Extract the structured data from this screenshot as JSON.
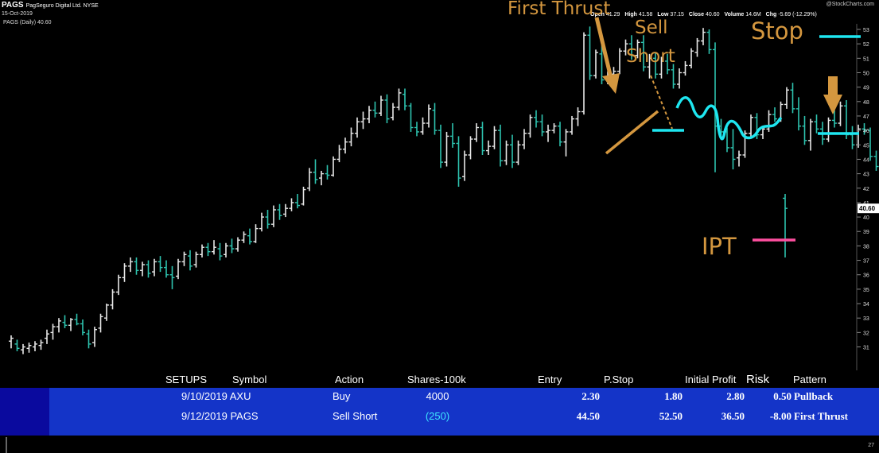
{
  "header": {
    "symbol": "PAGS",
    "company": "PagSeguro Digital Ltd.  NYSE",
    "date": "15-Oct-2019",
    "legend": "PAGS (Daily) 40.60",
    "watermark": "@StockCharts.com",
    "ohlc": {
      "open_label": "Open",
      "open": "41.29",
      "high_label": "High",
      "high": "41.58",
      "low_label": "Low",
      "low": "37.15",
      "close_label": "Close",
      "close": "40.60",
      "volume_label": "Volume",
      "volume": "14.6M",
      "chg_label": "Chg",
      "chg": "-5.69 (-12.29%)"
    }
  },
  "annotations": {
    "first_thrust": "First Thrust",
    "sell": "Sell",
    "short": "Short",
    "stop": "Stop",
    "ipt": "IPT"
  },
  "colors": {
    "up_bar": "#e8e8e8",
    "down_bar": "#2ec4b0",
    "annotation": "#d4973f",
    "cyan": "#1ee6f0",
    "magenta": "#ff4fa0",
    "table_bg": "#1434c8"
  },
  "chart_data": {
    "type": "bar",
    "subtype": "ohlc",
    "title": "PAGS (Daily) 40.60",
    "ylim": [
      30.5,
      53.5
    ],
    "y_ticks": [
      31,
      32,
      33,
      34,
      35,
      36,
      37,
      38,
      39,
      40,
      41,
      42,
      43,
      44,
      45,
      46,
      47,
      48,
      49,
      50,
      51,
      52,
      53
    ],
    "last_price_label": "40.60",
    "x_days": 133,
    "bars": [
      [
        31.4,
        31.8,
        30.9,
        31.6
      ],
      [
        31.2,
        31.5,
        30.7,
        30.9
      ],
      [
        30.8,
        31.2,
        30.5,
        31.0
      ],
      [
        30.9,
        31.3,
        30.6,
        31.1
      ],
      [
        31.0,
        31.4,
        30.7,
        31.2
      ],
      [
        31.1,
        31.5,
        30.8,
        31.3
      ],
      [
        31.6,
        32.2,
        31.2,
        31.9
      ],
      [
        32.0,
        32.6,
        31.5,
        32.4
      ],
      [
        32.4,
        33.0,
        32.0,
        32.8
      ],
      [
        32.7,
        33.2,
        32.3,
        32.5
      ],
      [
        32.5,
        33.0,
        32.1,
        32.9
      ],
      [
        32.9,
        33.3,
        32.5,
        32.6
      ],
      [
        32.6,
        32.9,
        31.8,
        32.0
      ],
      [
        31.9,
        32.2,
        30.9,
        31.2
      ],
      [
        31.3,
        32.4,
        31.0,
        32.2
      ],
      [
        32.3,
        33.3,
        32.0,
        33.1
      ],
      [
        33.0,
        34.0,
        32.8,
        33.9
      ],
      [
        33.9,
        35.0,
        33.6,
        34.8
      ],
      [
        34.8,
        36.0,
        34.6,
        35.8
      ],
      [
        35.8,
        36.8,
        35.5,
        36.6
      ],
      [
        36.6,
        37.2,
        36.2,
        36.9
      ],
      [
        36.9,
        37.2,
        36.0,
        36.3
      ],
      [
        36.3,
        36.9,
        35.9,
        36.7
      ],
      [
        36.7,
        37.0,
        35.8,
        36.1
      ],
      [
        36.2,
        37.1,
        35.9,
        36.9
      ],
      [
        36.9,
        37.3,
        36.2,
        36.5
      ],
      [
        36.5,
        37.0,
        35.8,
        36.0
      ],
      [
        36.0,
        36.6,
        35.0,
        35.8
      ],
      [
        35.9,
        37.1,
        35.7,
        36.9
      ],
      [
        36.9,
        37.6,
        36.6,
        37.4
      ],
      [
        37.3,
        37.7,
        36.3,
        36.6
      ],
      [
        36.7,
        37.6,
        36.5,
        37.4
      ],
      [
        37.4,
        38.1,
        37.2,
        37.9
      ],
      [
        37.9,
        38.2,
        37.3,
        37.6
      ],
      [
        37.6,
        38.4,
        37.4,
        37.9
      ],
      [
        37.8,
        38.2,
        37.0,
        37.3
      ],
      [
        37.4,
        38.2,
        37.2,
        38.0
      ],
      [
        38.0,
        38.5,
        37.5,
        37.8
      ],
      [
        37.8,
        38.6,
        37.6,
        38.4
      ],
      [
        38.4,
        39.0,
        38.2,
        38.8
      ],
      [
        38.7,
        39.2,
        38.1,
        38.3
      ],
      [
        38.3,
        39.5,
        38.2,
        39.2
      ],
      [
        39.2,
        40.3,
        39.0,
        40.0
      ],
      [
        40.0,
        40.5,
        39.2,
        39.5
      ],
      [
        39.5,
        40.8,
        39.3,
        40.5
      ],
      [
        40.5,
        40.9,
        39.8,
        40.1
      ],
      [
        40.2,
        40.9,
        40.0,
        40.6
      ],
      [
        40.6,
        41.3,
        40.4,
        41.0
      ],
      [
        41.0,
        41.6,
        40.6,
        40.8
      ],
      [
        40.9,
        42.1,
        40.8,
        41.9
      ],
      [
        42.0,
        43.4,
        41.8,
        43.1
      ],
      [
        43.1,
        44.0,
        42.3,
        42.6
      ],
      [
        42.7,
        43.2,
        42.2,
        43.0
      ],
      [
        43.0,
        43.6,
        42.6,
        42.9
      ],
      [
        42.9,
        44.2,
        42.8,
        44.0
      ],
      [
        44.0,
        45.0,
        43.8,
        44.7
      ],
      [
        44.7,
        45.5,
        44.4,
        45.2
      ],
      [
        45.2,
        46.2,
        44.9,
        45.8
      ],
      [
        45.8,
        46.9,
        45.5,
        46.6
      ],
      [
        46.6,
        47.3,
        46.1,
        46.8
      ],
      [
        46.8,
        47.7,
        46.5,
        47.4
      ],
      [
        47.4,
        48.0,
        46.9,
        47.2
      ],
      [
        47.2,
        48.4,
        47.0,
        48.1
      ],
      [
        48.1,
        48.5,
        46.5,
        46.8
      ],
      [
        46.9,
        47.9,
        46.7,
        47.6
      ],
      [
        47.6,
        48.9,
        47.4,
        48.6
      ],
      [
        48.5,
        48.9,
        47.4,
        47.7
      ],
      [
        47.7,
        47.9,
        45.9,
        46.2
      ],
      [
        46.2,
        46.6,
        45.6,
        45.9
      ],
      [
        45.9,
        46.9,
        45.7,
        46.5
      ],
      [
        46.5,
        47.8,
        46.2,
        47.5
      ],
      [
        47.4,
        47.9,
        45.7,
        46.0
      ],
      [
        46.0,
        46.4,
        43.4,
        43.8
      ],
      [
        43.8,
        45.9,
        43.5,
        45.6
      ],
      [
        45.6,
        46.5,
        44.8,
        45.1
      ],
      [
        45.1,
        45.6,
        42.1,
        42.7
      ],
      [
        42.8,
        44.6,
        42.5,
        44.3
      ],
      [
        44.3,
        45.6,
        44.0,
        45.4
      ],
      [
        45.4,
        46.5,
        45.2,
        46.2
      ],
      [
        46.2,
        46.6,
        44.3,
        44.6
      ],
      [
        44.6,
        45.3,
        44.3,
        44.9
      ],
      [
        44.9,
        46.3,
        44.7,
        46.0
      ],
      [
        46.0,
        46.4,
        43.5,
        43.9
      ],
      [
        43.9,
        45.3,
        43.6,
        45.0
      ],
      [
        45.0,
        45.7,
        43.4,
        43.8
      ],
      [
        43.8,
        45.3,
        43.6,
        45.0
      ],
      [
        45.0,
        46.1,
        44.7,
        45.8
      ],
      [
        45.8,
        47.1,
        45.5,
        46.9
      ],
      [
        46.9,
        47.4,
        46.2,
        46.6
      ],
      [
        46.6,
        47.1,
        45.6,
        45.9
      ],
      [
        45.9,
        46.4,
        45.2,
        46.0
      ],
      [
        46.0,
        46.5,
        45.8,
        46.3
      ],
      [
        46.3,
        46.6,
        44.9,
        45.2
      ],
      [
        45.2,
        46.1,
        44.2,
        45.9
      ],
      [
        45.9,
        47.0,
        45.7,
        46.8
      ],
      [
        46.8,
        47.6,
        46.3,
        47.3
      ],
      [
        47.3,
        52.8,
        47.1,
        52.6
      ],
      [
        52.6,
        53.2,
        49.5,
        49.8
      ],
      [
        49.8,
        51.6,
        49.6,
        51.4
      ],
      [
        51.3,
        51.9,
        49.2,
        49.5
      ],
      [
        49.5,
        50.1,
        49.2,
        49.9
      ],
      [
        49.9,
        50.4,
        49.4,
        50.1
      ],
      [
        50.1,
        51.7,
        49.9,
        51.5
      ],
      [
        51.5,
        52.3,
        51.2,
        52.0
      ],
      [
        52.0,
        52.6,
        50.9,
        51.2
      ],
      [
        51.2,
        52.3,
        51.0,
        52.1
      ],
      [
        52.1,
        52.6,
        50.1,
        50.4
      ],
      [
        50.4,
        51.3,
        49.6,
        51.0
      ],
      [
        51.0,
        51.4,
        49.6,
        49.9
      ],
      [
        49.9,
        51.1,
        49.6,
        50.8
      ],
      [
        50.8,
        51.3,
        49.9,
        50.2
      ],
      [
        50.2,
        50.6,
        48.9,
        49.2
      ],
      [
        49.2,
        50.3,
        48.9,
        50.0
      ],
      [
        50.0,
        50.8,
        49.8,
        50.5
      ],
      [
        50.5,
        51.7,
        50.3,
        51.5
      ],
      [
        51.4,
        52.4,
        51.1,
        52.2
      ],
      [
        52.2,
        53.1,
        51.9,
        52.8
      ],
      [
        52.8,
        53.0,
        51.3,
        51.6
      ],
      [
        51.6,
        52.1,
        43.1,
        46.3
      ],
      [
        46.3,
        46.8,
        45.6,
        45.9
      ],
      [
        45.9,
        46.2,
        44.5,
        44.8
      ],
      [
        44.8,
        46.1,
        43.3,
        44.0
      ],
      [
        44.1,
        44.6,
        43.5,
        44.3
      ],
      [
        44.3,
        46.0,
        44.1,
        45.8
      ],
      [
        45.8,
        47.1,
        45.5,
        46.9
      ],
      [
        46.9,
        47.2,
        45.4,
        45.7
      ],
      [
        45.7,
        46.3,
        45.4,
        46.1
      ],
      [
        46.1,
        47.4,
        45.9,
        47.1
      ],
      [
        47.1,
        47.6,
        46.6,
        46.8
      ],
      [
        46.8,
        48.0,
        46.6,
        47.8
      ],
      [
        47.8,
        49.0,
        47.5,
        48.8
      ],
      [
        48.8,
        49.3,
        47.2,
        47.5
      ],
      [
        47.5,
        48.3,
        46.0,
        46.3
      ],
      [
        46.3,
        47.0,
        45.0,
        45.3
      ],
      [
        45.3,
        46.8,
        44.6,
        46.6
      ],
      [
        46.6,
        47.1,
        45.8,
        46.1
      ],
      [
        46.1,
        46.6,
        45.0,
        45.4
      ],
      [
        45.4,
        46.9,
        45.2,
        46.7
      ],
      [
        46.7,
        47.4,
        46.2,
        46.5
      ],
      [
        46.5,
        48.0,
        46.3,
        47.7
      ],
      [
        47.7,
        48.1,
        45.4,
        45.7
      ],
      [
        45.7,
        46.3,
        44.7,
        45.0
      ],
      [
        45.0,
        46.4,
        44.8,
        46.1
      ],
      [
        46.1,
        46.5,
        45.7,
        46.0
      ],
      [
        46.0,
        46.2,
        43.9,
        44.2
      ],
      [
        44.2,
        44.6,
        43.2,
        43.5
      ],
      [
        43.5,
        44.7,
        43.1,
        44.4
      ],
      [
        44.4,
        45.2,
        43.8,
        45.0
      ],
      [
        45.0,
        46.0,
        44.8,
        45.7
      ],
      [
        45.7,
        46.3,
        45.4,
        45.9
      ],
      [
        45.9,
        46.2,
        44.9,
        45.2
      ],
      [
        45.2,
        45.6,
        44.6,
        44.9
      ],
      [
        44.9,
        45.8,
        44.2,
        45.6
      ],
      [
        45.6,
        45.9,
        44.2,
        44.5
      ],
      [
        44.5,
        45.3,
        44.3,
        45.0
      ],
      [
        45.0,
        45.2,
        44.1,
        44.4
      ],
      [
        44.4,
        45.6,
        44.3,
        45.3
      ],
      [
        45.3,
        45.7,
        44.7,
        45.0
      ],
      [
        45.0,
        46.4,
        44.8,
        46.1
      ],
      [
        46.1,
        46.9,
        45.4,
        45.7
      ],
      [
        45.7,
        47.0,
        45.5,
        46.5
      ],
      [
        46.3,
        46.6,
        45.6,
        46.3
      ],
      [
        41.3,
        41.6,
        37.2,
        40.6
      ]
    ]
  },
  "table": {
    "headers": [
      "SETUPS",
      "Symbol",
      "Action",
      "Shares-100k",
      "Entry",
      "P.Stop",
      "Initial Profit",
      "Risk",
      "Pattern"
    ],
    "rows": [
      {
        "setup": "9/10/2019 AXU",
        "action": "Buy",
        "shares": "4000",
        "entry": "2.30",
        "stop": "1.80",
        "profit": "2.80",
        "risk": "0.50",
        "pattern": "Pullback"
      },
      {
        "setup": "9/12/2019 PAGS",
        "action": "Sell Short",
        "shares": "(250)",
        "entry": "44.50",
        "stop": "52.50",
        "profit": "36.50",
        "risk": "-8.00",
        "pattern": "First Thrust"
      }
    ]
  }
}
